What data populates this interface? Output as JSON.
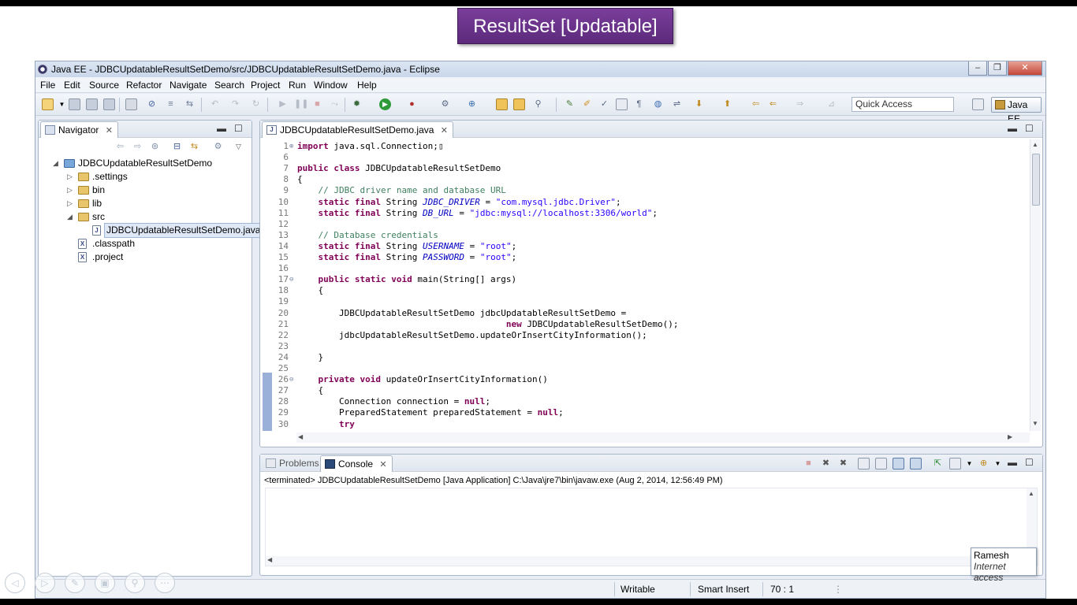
{
  "slide": {
    "title": "ResultSet [Updatable]"
  },
  "window": {
    "title": "Java EE - JDBCUpdatableResultSetDemo/src/JDBCUpdatableResultSetDemo.java - Eclipse",
    "minimize": "–",
    "maximize": "❐",
    "close": "✕"
  },
  "menu": [
    "File",
    "Edit",
    "Source",
    "Refactor",
    "Navigate",
    "Search",
    "Project",
    "Run",
    "Window",
    "Help"
  ],
  "toolbar": {
    "quick_access": "Quick Access",
    "perspective": "Java EE"
  },
  "navigator": {
    "tab_label": "Navigator",
    "tree": [
      {
        "label": "JDBCUpdatableResultSetDemo",
        "type": "project",
        "depth": 0,
        "expanded": true
      },
      {
        "label": ".settings",
        "type": "folder",
        "depth": 1,
        "expanded": false
      },
      {
        "label": "bin",
        "type": "folder",
        "depth": 1,
        "expanded": false
      },
      {
        "label": "lib",
        "type": "folder",
        "depth": 1,
        "expanded": false
      },
      {
        "label": "src",
        "type": "folder",
        "depth": 1,
        "expanded": true
      },
      {
        "label": "JDBCUpdatableResultSetDemo.java",
        "type": "java",
        "depth": 2,
        "selected": true
      },
      {
        "label": ".classpath",
        "type": "xml",
        "depth": 1
      },
      {
        "label": ".project",
        "type": "xml",
        "depth": 1
      }
    ]
  },
  "editor": {
    "tab_label": "JDBCUpdatableResultSetDemo.java",
    "lines": [
      {
        "n": "1",
        "fold": "⊕",
        "tokens": [
          [
            "kw",
            "import"
          ],
          [
            "",
            "java.sql.Connection;"
          ],
          [
            "",
            "▯"
          ]
        ]
      },
      {
        "n": "6",
        "tokens": []
      },
      {
        "n": "7",
        "tokens": [
          [
            "kw",
            "public class"
          ],
          [
            "",
            "JDBCUpdatableResultSetDemo"
          ]
        ]
      },
      {
        "n": "8",
        "tokens": [
          [
            "",
            "{"
          ]
        ]
      },
      {
        "n": "9",
        "tokens": [
          [
            "",
            "    "
          ],
          [
            "cm",
            "// JDBC driver name and database URL"
          ]
        ]
      },
      {
        "n": "10",
        "tokens": [
          [
            "",
            "    "
          ],
          [
            "kw",
            "static final"
          ],
          [
            "",
            "String"
          ],
          [
            "fld",
            "JDBC_DRIVER"
          ],
          [
            "",
            "="
          ],
          [
            "str",
            "\"com.mysql.jdbc.Driver\""
          ],
          [
            "",
            ";"
          ]
        ]
      },
      {
        "n": "11",
        "tokens": [
          [
            "",
            "    "
          ],
          [
            "kw",
            "static final"
          ],
          [
            "",
            "String"
          ],
          [
            "fld",
            "DB_URL"
          ],
          [
            "",
            "="
          ],
          [
            "str",
            "\"jdbc:mysql://localhost:3306/world\""
          ],
          [
            "",
            ";"
          ]
        ]
      },
      {
        "n": "12",
        "tokens": []
      },
      {
        "n": "13",
        "tokens": [
          [
            "",
            "    "
          ],
          [
            "cm",
            "// Database credentials"
          ]
        ]
      },
      {
        "n": "14",
        "tokens": [
          [
            "",
            "    "
          ],
          [
            "kw",
            "static final"
          ],
          [
            "",
            "String"
          ],
          [
            "fld",
            "USERNAME"
          ],
          [
            "",
            "="
          ],
          [
            "str",
            "\"root\""
          ],
          [
            "",
            ";"
          ]
        ]
      },
      {
        "n": "15",
        "tokens": [
          [
            "",
            "    "
          ],
          [
            "kw",
            "static final"
          ],
          [
            "",
            "String"
          ],
          [
            "fld",
            "PASSWORD"
          ],
          [
            "",
            "="
          ],
          [
            "str",
            "\"root\""
          ],
          [
            "",
            ";"
          ]
        ]
      },
      {
        "n": "16",
        "tokens": []
      },
      {
        "n": "17",
        "fold": "⊖",
        "tokens": [
          [
            "",
            "    "
          ],
          [
            "kw",
            "public static void"
          ],
          [
            "",
            "main(String[] args)"
          ]
        ]
      },
      {
        "n": "18",
        "tokens": [
          [
            "",
            "    {"
          ]
        ]
      },
      {
        "n": "19",
        "tokens": []
      },
      {
        "n": "20",
        "tokens": [
          [
            "",
            "        JDBCUpdatableResultSetDemo jdbcUpdatableResultSetDemo ="
          ]
        ]
      },
      {
        "n": "21",
        "tokens": [
          [
            "",
            "                                        "
          ],
          [
            "kw",
            "new"
          ],
          [
            "",
            "JDBCUpdatableResultSetDemo();"
          ]
        ]
      },
      {
        "n": "22",
        "tokens": [
          [
            "",
            "        jdbcUpdatableResultSetDemo.updateOrInsertCityInformation();"
          ]
        ]
      },
      {
        "n": "23",
        "tokens": []
      },
      {
        "n": "24",
        "tokens": [
          [
            "",
            "    }"
          ]
        ]
      },
      {
        "n": "25",
        "tokens": []
      },
      {
        "n": "26",
        "fold": "⊖",
        "tokens": [
          [
            "",
            "    "
          ],
          [
            "kw",
            "private void"
          ],
          [
            "",
            "updateOrInsertCityInformation()"
          ]
        ]
      },
      {
        "n": "27",
        "tokens": [
          [
            "",
            "    {"
          ]
        ]
      },
      {
        "n": "28",
        "tokens": [
          [
            "",
            "        Connection connection = "
          ],
          [
            "kw",
            "null"
          ],
          [
            "",
            ";"
          ]
        ]
      },
      {
        "n": "29",
        "tokens": [
          [
            "",
            "        PreparedStatement preparedStatement = "
          ],
          [
            "kw",
            "null"
          ],
          [
            "",
            ";"
          ]
        ]
      },
      {
        "n": "30",
        "tokens": [
          [
            "",
            "        "
          ],
          [
            "kw",
            "try"
          ]
        ]
      }
    ]
  },
  "console": {
    "tabs": [
      "Problems",
      "Console"
    ],
    "status": "<terminated> JDBCUpdatableResultSetDemo [Java Application] C:\\Java\\jre7\\bin\\javaw.exe (Aug 2, 2014, 12:56:49 PM)"
  },
  "statusbar": {
    "writable": "Writable",
    "insert_mode": "Smart Insert",
    "position": "70 : 1",
    "dots": "⋮"
  },
  "tooltip": {
    "name": "Ramesh",
    "detail": "Internet access"
  },
  "colors": {
    "keyword": "#7f0055",
    "string": "#2a00ff",
    "comment": "#3f7f5f",
    "field": "#0000c0",
    "slide_title_bg": "#6a3490"
  }
}
